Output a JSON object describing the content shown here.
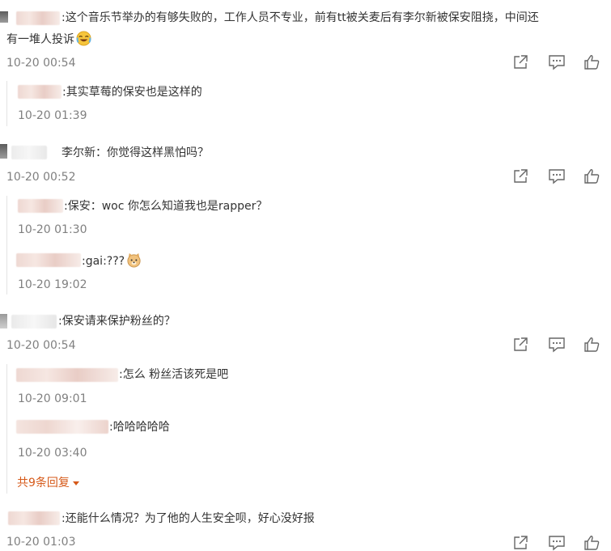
{
  "comments": [
    {
      "text": ":这个音乐节举办的有够失败的，工作人员不专业，前有tt被关麦后有李尔新被保安阻挠，中间还",
      "text_line2": "有一堆人投诉",
      "time": "10-20 00:54",
      "replies": [
        {
          "text": ":其实草莓的保安也是这样的",
          "time": "10-20 01:39"
        }
      ]
    },
    {
      "text": "李尔新：你觉得这样黑怕吗？",
      "time": "10-20 00:52",
      "replies": [
        {
          "text": ":保安：woc 你怎么知道我也是rapper？",
          "time": "10-20 01:30"
        },
        {
          "text": ":gai:???",
          "time": "10-20 19:02"
        }
      ]
    },
    {
      "text": ":保安请来保护粉丝的？",
      "time": "10-20 00:54",
      "replies": [
        {
          "text": ":怎么 粉丝活该死是吧",
          "time": "10-20 09:01"
        },
        {
          "text": ":哈哈哈哈哈",
          "time": "10-20 03:40"
        }
      ],
      "more_replies": "共9条回复"
    },
    {
      "text": ":还能什么情况？为了他的人生安全呗，好心没好报",
      "time": "10-20 01:03",
      "replies": []
    }
  ],
  "icons": {
    "share": "share-icon",
    "comment": "comment-icon",
    "like": "like-icon",
    "emoji_cry_laugh": "laugh-cry-emoji",
    "emoji_doge": "doge-emoji"
  },
  "colors": {
    "text": "#333333",
    "time": "#808080",
    "more_link": "#d65a1a",
    "divider": "#e4e4e4"
  }
}
